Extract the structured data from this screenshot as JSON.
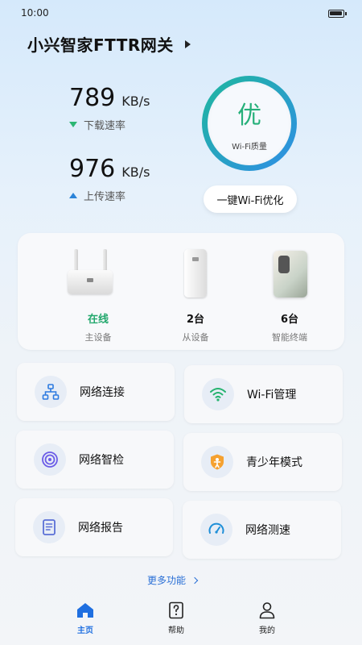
{
  "status_bar": {
    "time": "10:00"
  },
  "header": {
    "title": "小兴智家FTTR网关"
  },
  "speeds": {
    "download": {
      "value": "789",
      "unit": "KB/s",
      "label": "下载速率"
    },
    "upload": {
      "value": "976",
      "unit": "KB/s",
      "label": "上传速率"
    }
  },
  "wifi_quality": {
    "grade": "优",
    "label": "Wi-Fi质量",
    "ring_colors": [
      "#1fb6a0",
      "#2f8fe4"
    ]
  },
  "optimize_button": {
    "label": "一键Wi-Fi优化"
  },
  "devices": [
    {
      "status": "在线",
      "subtitle": "主设备"
    },
    {
      "status": "2台",
      "subtitle": "从设备"
    },
    {
      "status": "6台",
      "subtitle": "智能终端"
    }
  ],
  "functions": [
    {
      "label": "网络连接",
      "icon": "network-topology-icon"
    },
    {
      "label": "Wi-Fi管理",
      "icon": "wifi-icon"
    },
    {
      "label": "网络智检",
      "icon": "network-check-icon"
    },
    {
      "label": "青少年模式",
      "icon": "child-shield-icon"
    },
    {
      "label": "网络报告",
      "icon": "report-icon"
    },
    {
      "label": "网络测速",
      "icon": "speedometer-icon"
    }
  ],
  "more_features": {
    "label": "更多功能"
  },
  "tabs": [
    {
      "label": "主页",
      "icon": "home-icon",
      "active": true
    },
    {
      "label": "帮助",
      "icon": "help-icon",
      "active": false
    },
    {
      "label": "我的",
      "icon": "profile-icon",
      "active": false
    }
  ],
  "colors": {
    "accent": "#2a6fd6",
    "online_green": "#23a86d",
    "quality_green": "#26b07a"
  }
}
